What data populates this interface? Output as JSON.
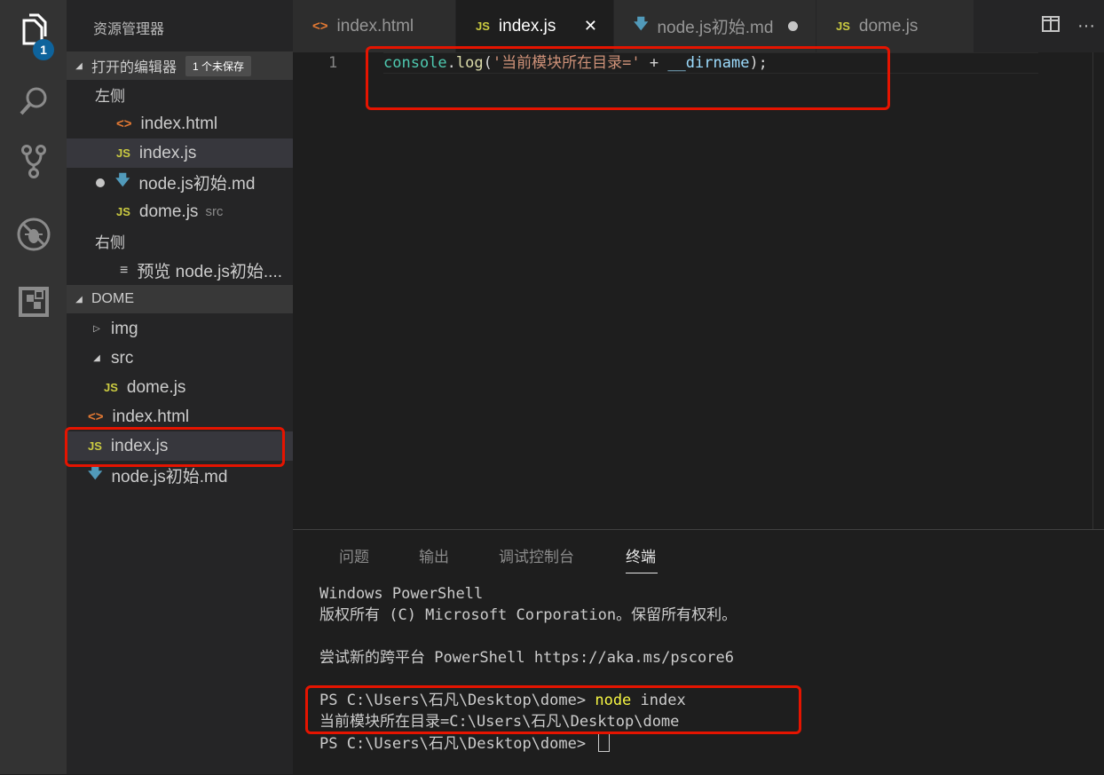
{
  "activity_bar": {
    "badge": "1"
  },
  "sidebar": {
    "title": "资源管理器",
    "open_editors": {
      "label": "打开的编辑器",
      "unsaved_badge": "1 个未保存",
      "groups": [
        {
          "label": "左侧",
          "items": [
            {
              "icon": "html-icon",
              "name": "index.html"
            },
            {
              "icon": "js-icon",
              "name": "index.js"
            },
            {
              "icon": "markdown-icon",
              "name": "node.js初始.md"
            },
            {
              "icon": "js-icon",
              "name": "dome.js",
              "desc": "src"
            }
          ]
        },
        {
          "label": "右侧",
          "items": [
            {
              "icon": "preview-icon",
              "name": "预览 node.js初始...."
            }
          ]
        }
      ]
    },
    "folder": {
      "label": "DOME",
      "items": [
        {
          "name": "img",
          "type": "folder"
        },
        {
          "name": "src",
          "type": "folder"
        },
        {
          "name": "dome.js",
          "type": "js"
        },
        {
          "name": "index.html",
          "type": "html"
        },
        {
          "name": "index.js",
          "type": "js"
        },
        {
          "name": "node.js初始.md",
          "type": "md"
        }
      ]
    }
  },
  "tabs": [
    {
      "icon_text": "<>",
      "label": "index.html"
    },
    {
      "icon_text": "JS",
      "label": "index.js",
      "close": "✕"
    },
    {
      "icon_text": "🡇",
      "label": "node.js初始.md"
    },
    {
      "icon_text": "JS",
      "label": "dome.js"
    }
  ],
  "icon_glyphs": {
    "js": "JS",
    "html": "<>",
    "md": "🡇",
    "preview": "≡",
    "more": "···",
    "tri_down": "◢",
    "tri_right": "▷"
  },
  "editor": {
    "line_number": "1",
    "code": {
      "ident": "console",
      "dot": ".",
      "fn": "log",
      "open": "(",
      "str": "'当前模块所在目录='",
      "plus": " + ",
      "var": "__dirname",
      "close": ");"
    }
  },
  "panel": {
    "tabs": [
      "问题",
      "输出",
      "调试控制台",
      "终端"
    ],
    "terminal": {
      "line1": "Windows PowerShell",
      "line2": "版权所有 (C) Microsoft Corporation。保留所有权利。",
      "line3": "尝试新的跨平台 PowerShell https://aka.ms/pscore6",
      "prompt1": "PS C:\\Users\\石凡\\Desktop\\dome> ",
      "cmd": "node",
      "arg": " index",
      "output": "当前模块所在目录=C:\\Users\\石凡\\Desktop\\dome",
      "prompt2": "PS C:\\Users\\石凡\\Desktop\\dome> "
    }
  },
  "colors": {
    "highlight_box": "#e51400",
    "js_icon": "#cbcb41",
    "html_icon": "#e37933",
    "md_icon": "#519aba"
  }
}
